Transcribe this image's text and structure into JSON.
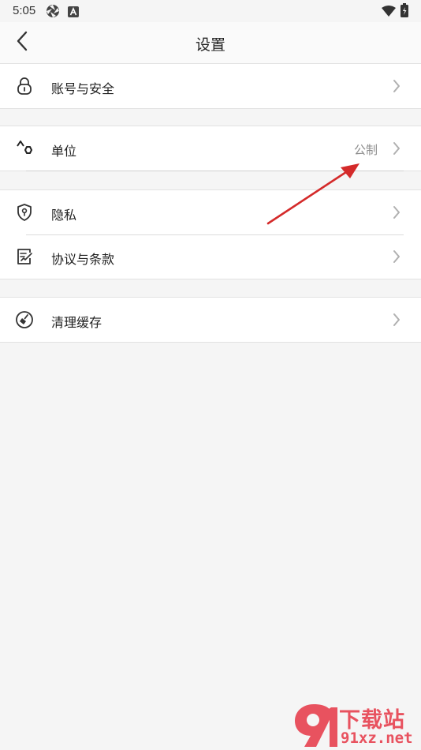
{
  "status_bar": {
    "time": "5:05",
    "icons": [
      "aperture-icon",
      "a-notification-icon",
      "wifi-icon",
      "battery-icon"
    ]
  },
  "header": {
    "title": "设置",
    "back_icon": "chevron-left-icon"
  },
  "groups": [
    {
      "items": [
        {
          "label": "账号与安全",
          "icon": "lock-icon",
          "value": ""
        }
      ]
    },
    {
      "items": [
        {
          "label": "单位",
          "icon": "unit-shapes-icon",
          "value": "公制"
        }
      ]
    },
    {
      "items": [
        {
          "label": "隐私",
          "icon": "shield-icon",
          "value": ""
        },
        {
          "label": "协议与条款",
          "icon": "document-icon",
          "value": ""
        }
      ]
    },
    {
      "items": [
        {
          "label": "清理缓存",
          "icon": "broom-icon",
          "value": ""
        }
      ]
    }
  ],
  "watermark": {
    "logo_icon": "91-logo-icon",
    "title": "下载站",
    "url": "91xz.net"
  },
  "colors": {
    "background": "#f5f5f5",
    "card": "#ffffff",
    "text": "#222222",
    "secondary_text": "#8c8c8c",
    "chevron": "#b0b0b0",
    "annotation_arrow": "#d42a2a",
    "watermark": "#e8525f"
  }
}
